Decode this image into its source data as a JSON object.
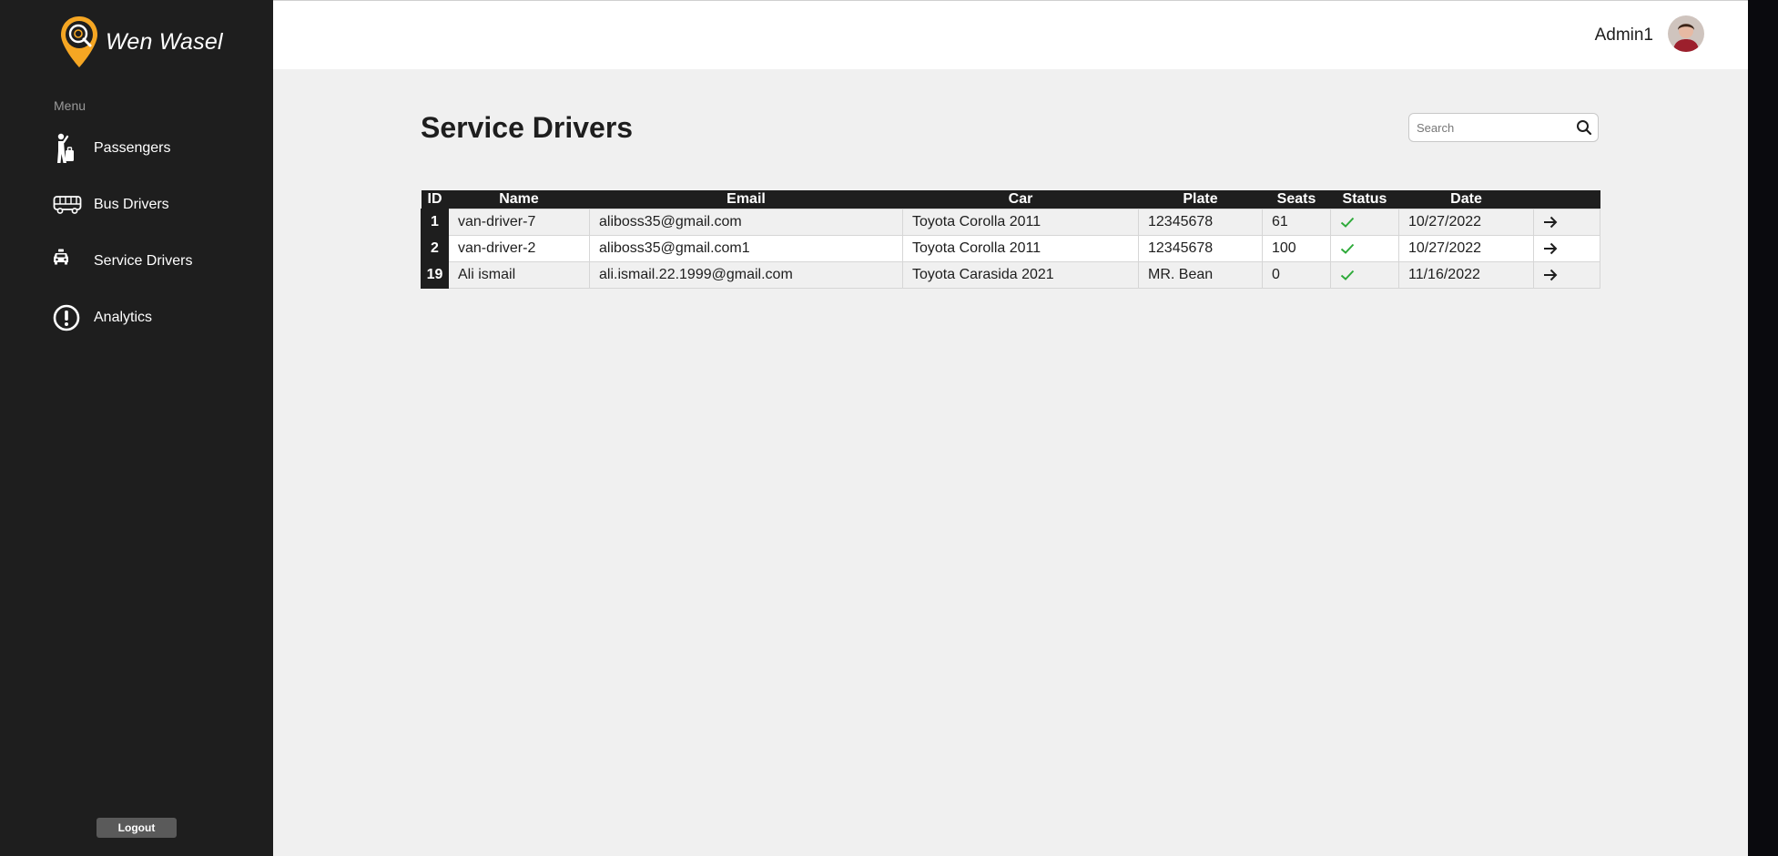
{
  "brand": {
    "name": "Wen Wasel",
    "accent": "#f5a623"
  },
  "sidebar": {
    "menu_label": "Menu",
    "items": [
      {
        "label": "Passengers",
        "icon": "passenger-icon"
      },
      {
        "label": "Bus Drivers",
        "icon": "bus-icon"
      },
      {
        "label": "Service Drivers",
        "icon": "taxi-icon"
      },
      {
        "label": "Analytics",
        "icon": "alert-circle-icon"
      }
    ],
    "logout_label": "Logout"
  },
  "header": {
    "admin_name": "Admin1"
  },
  "main": {
    "title": "Service Drivers",
    "search": {
      "placeholder": "Search",
      "value": ""
    }
  },
  "table": {
    "columns": [
      "ID",
      "Name",
      "Email",
      "Car",
      "Plate",
      "Seats",
      "Status",
      "Date",
      ""
    ],
    "rows": [
      {
        "id": "1",
        "name": "van-driver-7",
        "email": "aliboss35@gmail.com",
        "car": "Toyota Corolla 2011",
        "plate": "12345678",
        "seats": "61",
        "status": "active",
        "date": "10/27/2022"
      },
      {
        "id": "2",
        "name": "van-driver-2",
        "email": "aliboss35@gmail.com1",
        "car": "Toyota Corolla 2011",
        "plate": "12345678",
        "seats": "100",
        "status": "active",
        "date": "10/27/2022"
      },
      {
        "id": "19",
        "name": "Ali ismail",
        "email": "ali.ismail.22.1999@gmail.com",
        "car": "Toyota Carasida 2021",
        "plate": "MR. Bean",
        "seats": "0",
        "status": "active",
        "date": "11/16/2022"
      }
    ],
    "status_color": "#2eaa3a"
  }
}
